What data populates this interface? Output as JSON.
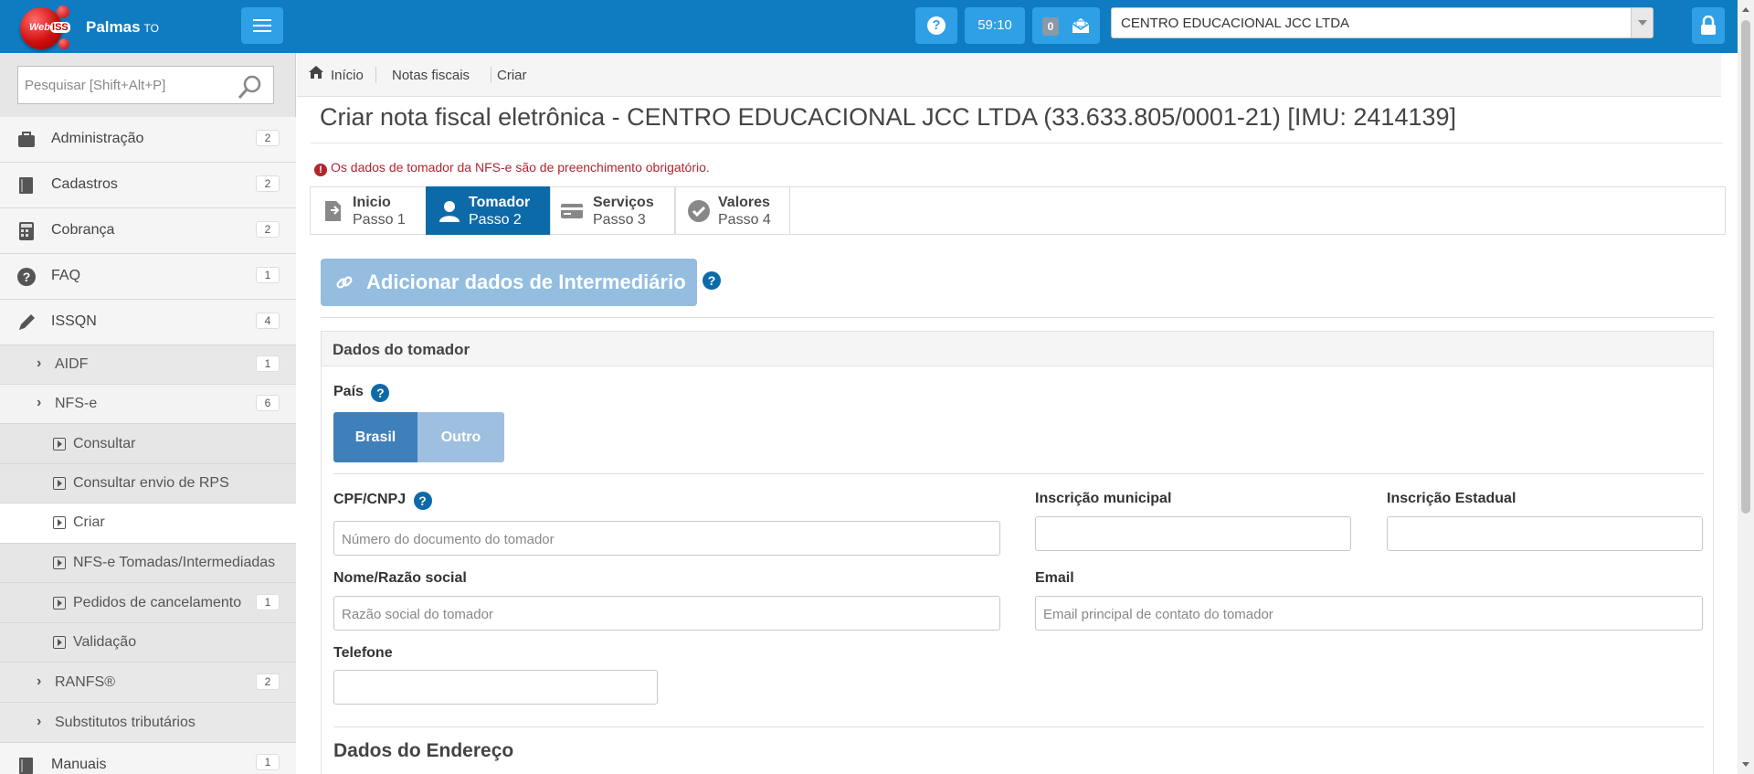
{
  "header": {
    "logo_text": "Web",
    "logo_suffix": "ISS",
    "city": "Palmas",
    "state": "TO",
    "help_label": "?",
    "timer": "59:10",
    "message_count": "0",
    "company": "CENTRO EDUCACIONAL JCC LTDA",
    "accent_color": "#0f7cc2"
  },
  "sidebar": {
    "search_placeholder": "Pesquisar [Shift+Alt+P]",
    "items": [
      {
        "label": "Administração",
        "badge": "2",
        "icon": "briefcase-icon"
      },
      {
        "label": "Cadastros",
        "badge": "2",
        "icon": "book-icon"
      },
      {
        "label": "Cobrança",
        "badge": "2",
        "icon": "calculator-icon"
      },
      {
        "label": "FAQ",
        "badge": "1",
        "icon": "question-icon"
      },
      {
        "label": "ISSQN",
        "badge": "4",
        "icon": "pencil-icon"
      }
    ],
    "sub_items": [
      {
        "label": "AIDF",
        "badge": "1"
      },
      {
        "label": "NFS-e",
        "badge": "6"
      }
    ],
    "leaves": [
      {
        "label": "Consultar",
        "badge": ""
      },
      {
        "label": "Consultar envio de RPS",
        "badge": ""
      },
      {
        "label": "Criar",
        "badge": ""
      },
      {
        "label": "NFS-e Tomadas/Intermediadas",
        "badge": ""
      },
      {
        "label": "Pedidos de cancelamento",
        "badge": "1"
      },
      {
        "label": "Validação",
        "badge": ""
      }
    ],
    "sub_items2": [
      {
        "label": "RANFS®",
        "badge": "2"
      },
      {
        "label": "Substitutos tributários",
        "badge": ""
      }
    ],
    "manuals": {
      "label": "Manuais",
      "badge": "1"
    }
  },
  "breadcrumb": [
    "Início",
    "Notas fiscais",
    "Criar"
  ],
  "page": {
    "title": "Criar nota fiscal eletrônica - CENTRO EDUCACIONAL JCC LTDA (33.633.805/0001-21) [IMU: 2414139]",
    "alert": "Os dados de tomador da NFS-e são de preenchimento obrigatório."
  },
  "steps": [
    {
      "title": "Inicio",
      "sub": "Passo 1"
    },
    {
      "title": "Tomador",
      "sub": "Passo 2"
    },
    {
      "title": "Serviços",
      "sub": "Passo 3"
    },
    {
      "title": "Valores",
      "sub": "Passo 4"
    }
  ],
  "intermediary_button": "Adicionar dados de Intermediário",
  "tomador": {
    "panel_title": "Dados do tomador",
    "pais_label": "País",
    "pais_options": [
      "Brasil",
      "Outro"
    ],
    "cpf_label": "CPF/CNPJ",
    "cpf_placeholder": "Número do documento do tomador",
    "im_label": "Inscrição municipal",
    "ie_label": "Inscrição Estadual",
    "nome_label": "Nome/Razão social",
    "nome_placeholder": "Razão social do tomador",
    "email_label": "Email",
    "email_placeholder": "Email principal de contato do tomador",
    "telefone_label": "Telefone"
  },
  "endereco_title": "Dados do Endereço"
}
